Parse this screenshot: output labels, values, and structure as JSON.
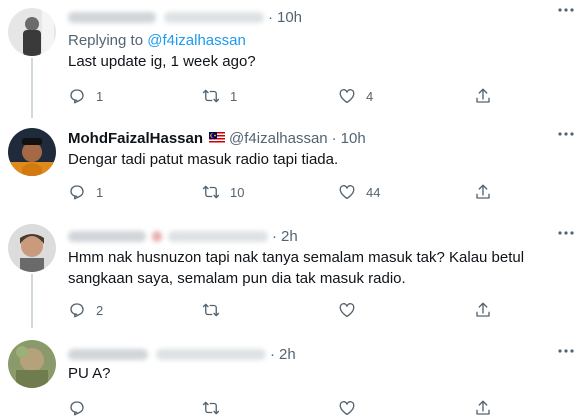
{
  "tweets": [
    {
      "name": "Aswan Abdullah",
      "handle": "@aswanyfizalus",
      "time": "10h",
      "replying_label": "Replying to",
      "replying_to": "@f4izalhassan",
      "text": "Last update ig, 1 week ago?",
      "replies": "1",
      "retweets": "1",
      "likes": "4"
    },
    {
      "name": "MohdFaizalHassan",
      "handle": "@f4izalhassan",
      "time": "10h",
      "text": "Dengar tadi patut masuk radio tapi tiada.",
      "replies": "1",
      "retweets": "10",
      "likes": "44"
    },
    {
      "name": "Langit Biru",
      "handle": "@fauwanullaus",
      "time": "2h",
      "text": "Hmm nak husnuzon tapi nak tanya semalam masuk tak? Kalau betul sangkaan saya, semalam pun dia tak masuk radio.",
      "replies": "2",
      "retweets": "",
      "likes": ""
    },
    {
      "name": "Bu Ang Yau",
      "handle": "@Puspanthess5",
      "time": "2h",
      "text": "PU A?",
      "replies": "",
      "retweets": "",
      "likes": ""
    }
  ],
  "colors": {
    "accent": "#1d9bf0",
    "muted": "#536471",
    "thread": "#cfd9de"
  },
  "icons": [
    "reply-icon",
    "retweet-icon",
    "like-icon",
    "share-icon",
    "more-icon",
    "malaysia-flag-icon"
  ]
}
